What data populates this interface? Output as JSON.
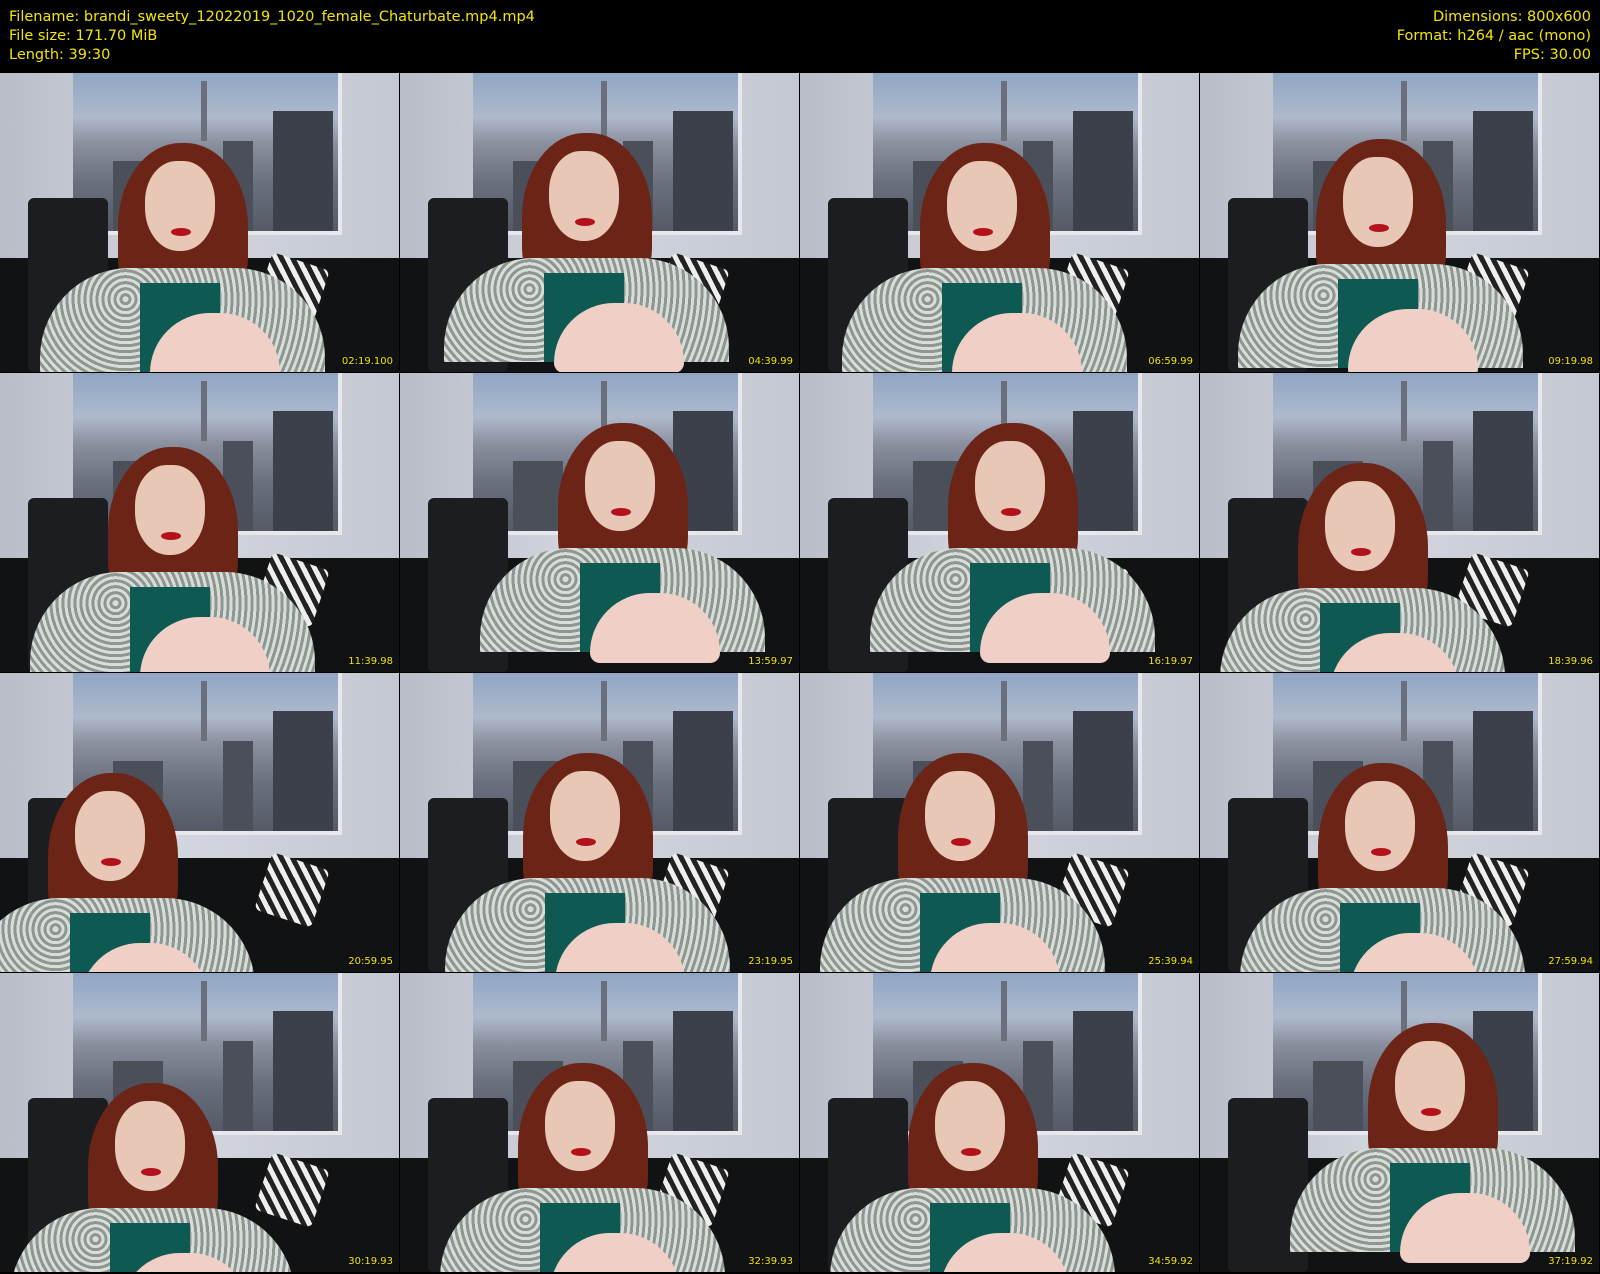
{
  "header": {
    "filename": "Filename: brandi_sweety_12022019_1020_female_Chaturbate.mp4.mp4",
    "filesize": "File size: 171.70 MiB",
    "length": "Length: 39:30",
    "dimensions": "Dimensions: 800x600",
    "format": "Format: h264 / aac (mono)",
    "fps": "FPS: 30.00"
  },
  "thumbnails": [
    {
      "timestamp": "02:19.100"
    },
    {
      "timestamp": "04:39.99"
    },
    {
      "timestamp": "06:59.99"
    },
    {
      "timestamp": "09:19.98"
    },
    {
      "timestamp": "11:39.98"
    },
    {
      "timestamp": "13:59.97"
    },
    {
      "timestamp": "16:19.97"
    },
    {
      "timestamp": "18:39.96"
    },
    {
      "timestamp": "20:59.95"
    },
    {
      "timestamp": "23:19.95"
    },
    {
      "timestamp": "25:39.94"
    },
    {
      "timestamp": "27:59.94"
    },
    {
      "timestamp": "30:19.93"
    },
    {
      "timestamp": "32:39.93"
    },
    {
      "timestamp": "34:59.92"
    },
    {
      "timestamp": "37:19.92"
    }
  ],
  "colors": {
    "header_text": "#f2e600",
    "background": "#000000"
  }
}
